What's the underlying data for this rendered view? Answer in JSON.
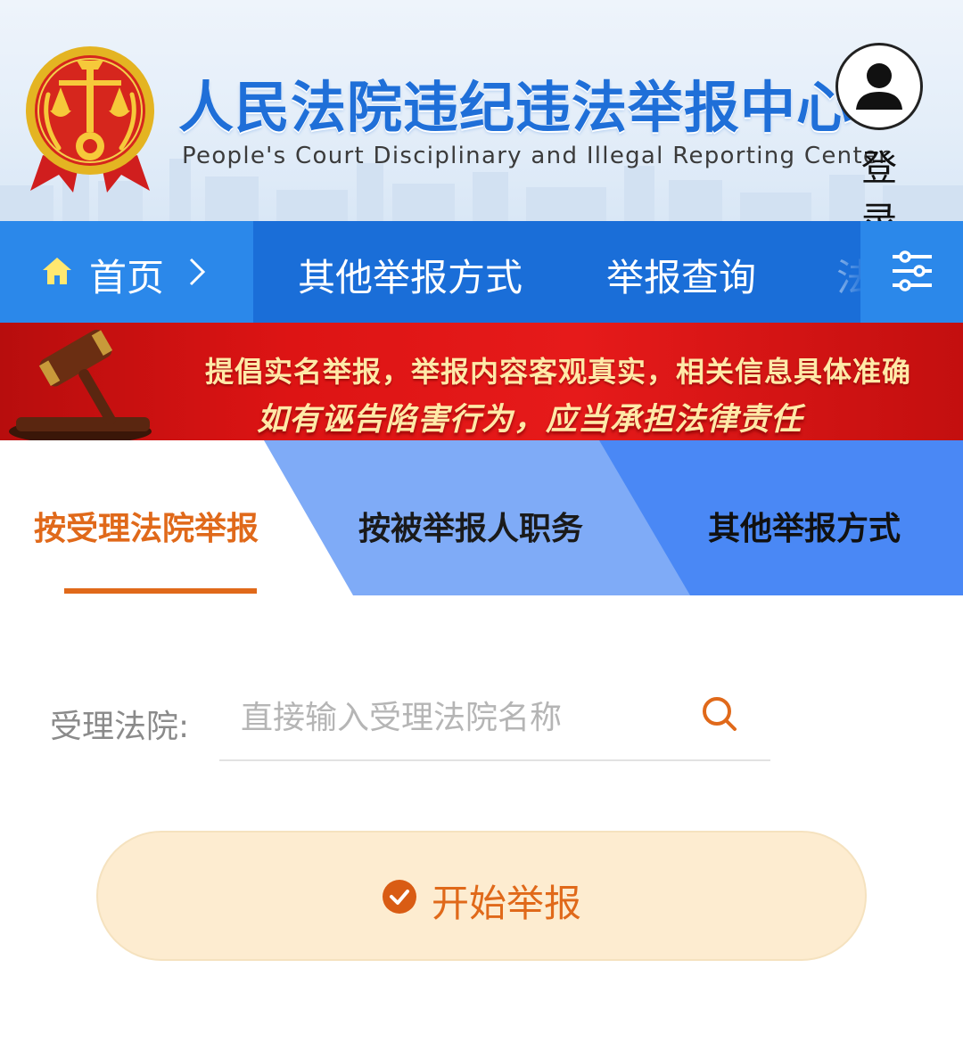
{
  "header": {
    "title": "人民法院违纪违法举报中心",
    "subtitle": "People's Court Disciplinary and Illegal Reporting Center",
    "login_label": "登录",
    "login_icon": "user-icon",
    "emblem_icon": "court-emblem-icon"
  },
  "nav": {
    "home_label": "首页",
    "home_icon": "home-icon",
    "items": [
      {
        "label": "其他举报方式"
      },
      {
        "label": "举报查询"
      },
      {
        "label": "法"
      }
    ],
    "more_icon": "sliders-menu-icon"
  },
  "banner": {
    "line1": "提倡实名举报，举报内容客观真实，相关信息具体准确",
    "line2": "如有诬告陷害行为，应当承担法律责任",
    "icon": "gavel-icon"
  },
  "tabs": [
    {
      "label": "按受理法院举报",
      "active": true
    },
    {
      "label": "按被举报人职务",
      "active": false
    },
    {
      "label": "其他举报方式",
      "active": false
    }
  ],
  "form": {
    "court_label": "受理法院:",
    "court_placeholder": "直接输入受理法院名称",
    "court_value": "",
    "search_icon": "search-icon"
  },
  "start_button": {
    "label": "开始举报",
    "icon": "check-circle-icon"
  },
  "colors": {
    "primary_blue": "#1a6ed8",
    "accent_orange": "#e0691a",
    "banner_red": "#dd1414",
    "title_blue": "#1f6fd8",
    "button_bg": "#fdecd0"
  }
}
